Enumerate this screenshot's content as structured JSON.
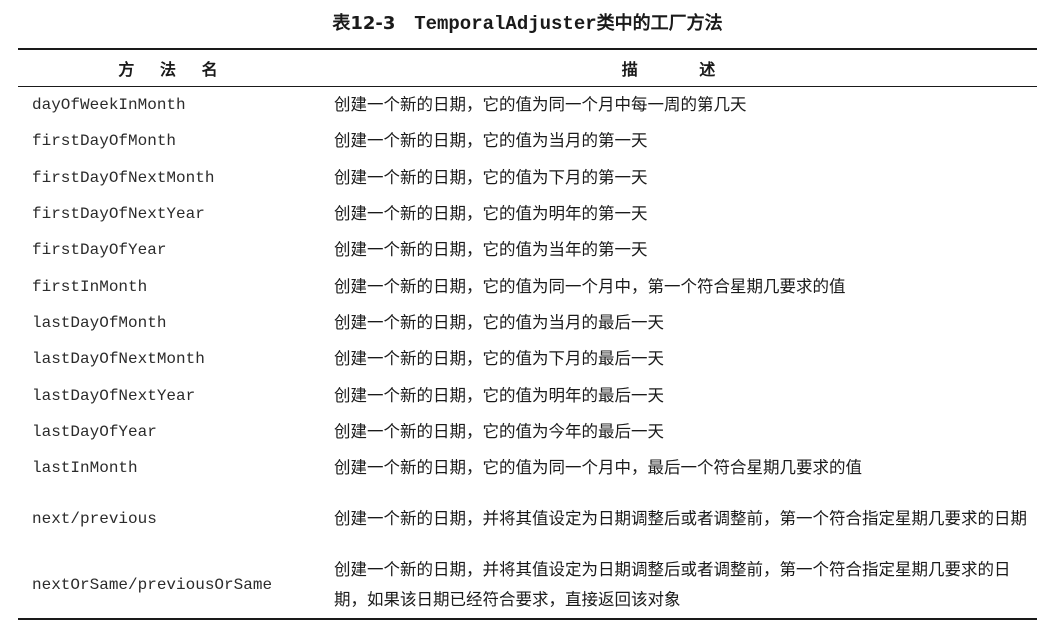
{
  "caption": {
    "prefix": "表12-3",
    "code": "TemporalAdjuster",
    "suffix": "类中的工厂方法"
  },
  "header": {
    "method": "方 法 名",
    "desc": "描 述"
  },
  "rows": [
    {
      "method": "dayOfWeekInMonth",
      "desc": "创建一个新的日期，它的值为同一个月中每一周的第几天"
    },
    {
      "method": "firstDayOfMonth",
      "desc": "创建一个新的日期，它的值为当月的第一天"
    },
    {
      "method": "firstDayOfNextMonth",
      "desc": "创建一个新的日期，它的值为下月的第一天"
    },
    {
      "method": "firstDayOfNextYear",
      "desc": "创建一个新的日期，它的值为明年的第一天"
    },
    {
      "method": "firstDayOfYear",
      "desc": "创建一个新的日期，它的值为当年的第一天"
    },
    {
      "method": "firstInMonth",
      "desc": "创建一个新的日期，它的值为同一个月中，第一个符合星期几要求的值"
    },
    {
      "method": "lastDayOfMonth",
      "desc": "创建一个新的日期，它的值为当月的最后一天"
    },
    {
      "method": "lastDayOfNextMonth",
      "desc": "创建一个新的日期，它的值为下月的最后一天"
    },
    {
      "method": "lastDayOfNextYear",
      "desc": "创建一个新的日期，它的值为明年的最后一天"
    },
    {
      "method": "lastDayOfYear",
      "desc": "创建一个新的日期，它的值为今年的最后一天"
    },
    {
      "method": "lastInMonth",
      "desc": "创建一个新的日期，它的值为同一个月中，最后一个符合星期几要求的值"
    },
    {
      "method": "next/previous",
      "desc": "创建一个新的日期，并将其值设定为日期调整后或者调整前，第一个符合指定星期几要求的日期"
    },
    {
      "method": "nextOrSame/previousOrSame",
      "desc": "创建一个新的日期，并将其值设定为日期调整后或者调整前，第一个符合指定星期几要求的日期，如果该日期已经符合要求，直接返回该对象"
    }
  ]
}
